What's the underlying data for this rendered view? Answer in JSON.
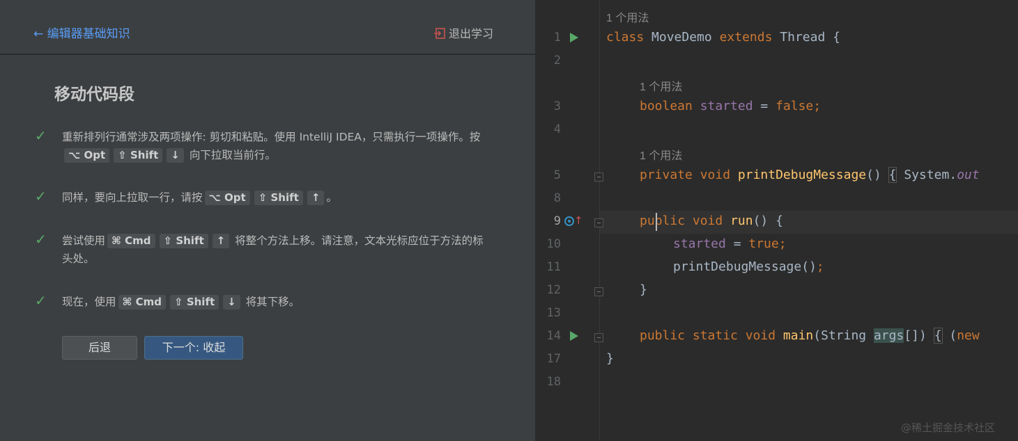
{
  "learn_panel": {
    "back_label": "← 编辑器基础知识",
    "exit_label": "退出学习",
    "lesson_title": "移动代码段",
    "steps": [
      {
        "text_before": "重新排列行通常涉及两项操作: 剪切和粘贴。使用 IntelliJ IDEA，只需执行一项操作。按",
        "keys": [
          "⌥ Opt",
          "⇧ Shift",
          "↓"
        ],
        "text_after": "向下拉取当前行。"
      },
      {
        "text_before": "同样，要向上拉取一行，请按",
        "keys": [
          "⌥ Opt",
          "⇧ Shift",
          "↑"
        ],
        "text_after": "。"
      },
      {
        "text_before": "尝试使用",
        "keys": [
          "⌘ Cmd",
          "⇧ Shift",
          "↑"
        ],
        "text_after": "将整个方法上移。请注意，文本光标应位于方法的标头处。"
      },
      {
        "text_before": "现在，使用",
        "keys": [
          "⌘ Cmd",
          "⇧ Shift",
          "↓"
        ],
        "text_after": "将其下移。"
      }
    ],
    "button_back": "后退",
    "button_next": "下一个: 收起"
  },
  "editor": {
    "usage_hint": "1 个用法",
    "line_numbers": [
      "1",
      "2",
      "3",
      "4",
      "5",
      "8",
      "9",
      "10",
      "11",
      "12",
      "13",
      "14",
      "17",
      "18"
    ],
    "code": {
      "l1_a": "class ",
      "l1_b": "MoveDemo ",
      "l1_c": "extends ",
      "l1_d": "Thread {",
      "l3_a": "boolean ",
      "l3_b": "started",
      "l3_c": " = ",
      "l3_d": "false;",
      "l5_a": "private void ",
      "l5_b": "printDebugMessage",
      "l5_c": "() ",
      "l5_d": "{",
      "l5_e": " System.",
      "l5_f": "out",
      "l9_a": "pu",
      "l9_b": "blic void ",
      "l9_c": "run",
      "l9_d": "() {",
      "l10_a": "started",
      "l10_b": " = ",
      "l10_c": "true;",
      "l11_a": "printDebugMessage()",
      "l11_b": ";",
      "l12": "}",
      "l14_a": "public static void ",
      "l14_b": "main",
      "l14_c": "(String ",
      "l14_d": "args",
      "l14_e": "[]) ",
      "l14_f": "{",
      "l14_g": " (",
      "l14_h": "new",
      "l17": "}"
    }
  },
  "watermark": "@稀土掘金技术社区"
}
